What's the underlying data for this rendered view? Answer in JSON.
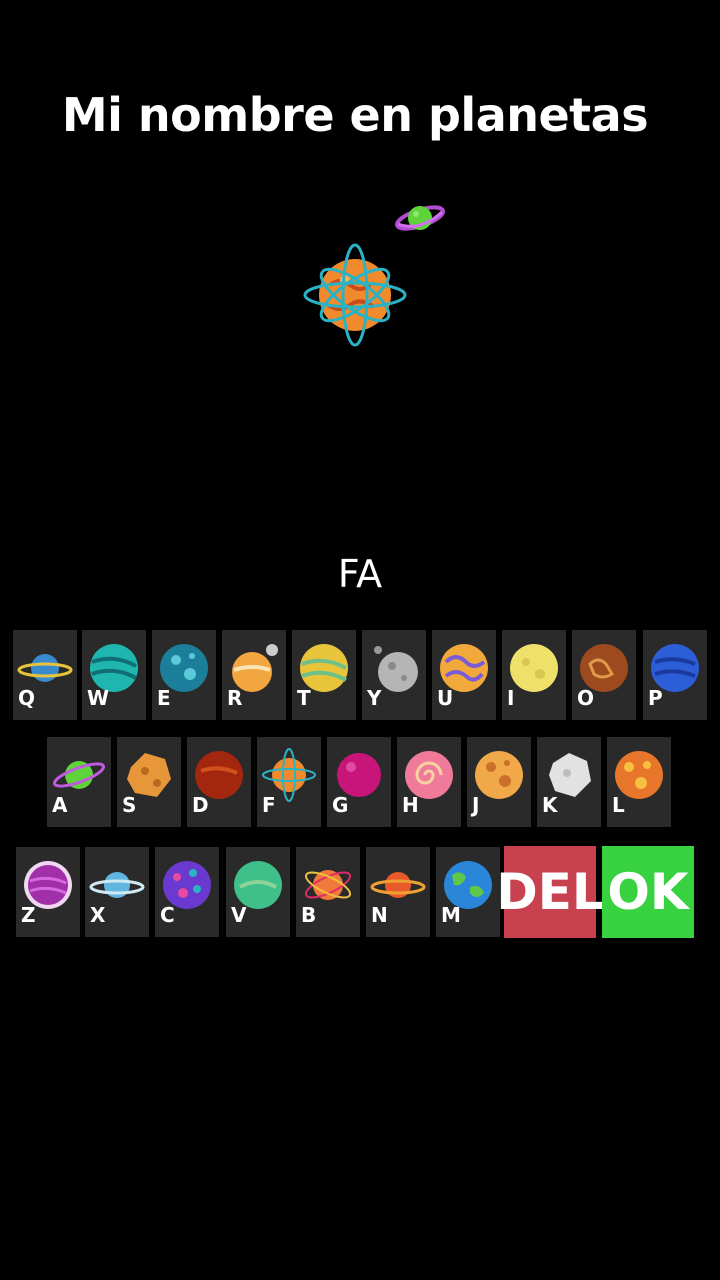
{
  "title": "Mi nombre en planetas",
  "typed_text": "FA",
  "keyboard": {
    "row1": [
      "Q",
      "W",
      "E",
      "R",
      "T",
      "Y",
      "U",
      "I",
      "O",
      "P"
    ],
    "row2": [
      "A",
      "S",
      "D",
      "F",
      "G",
      "H",
      "J",
      "K",
      "L"
    ],
    "row3": [
      "Z",
      "X",
      "C",
      "V",
      "B",
      "N",
      "M"
    ]
  },
  "actions": {
    "delete_label": "DEL",
    "ok_label": "OK"
  },
  "colors": {
    "background": "#000000",
    "key_bg": "#2a2a2a",
    "delete": "#c8414f",
    "ok": "#38d13f"
  },
  "planet_icons": {
    "Q": "blue-ringed-planet-icon",
    "W": "teal-planet-icon",
    "E": "blue-crater-planet-icon",
    "R": "orange-planet-moon-icon",
    "T": "yellow-green-planet-icon",
    "Y": "grey-moon-icon",
    "U": "swirl-planet-icon",
    "I": "yellow-moon-icon",
    "O": "brown-planet-icon",
    "P": "blue-planet-icon",
    "A": "green-ringed-planet-icon",
    "S": "orange-asteroid-icon",
    "D": "red-planet-icon",
    "F": "orange-orbit-planet-icon",
    "G": "magenta-planet-icon",
    "H": "pink-swirl-planet-icon",
    "J": "orange-crater-planet-icon",
    "K": "white-asteroid-icon",
    "L": "orange-spotted-planet-icon",
    "Z": "purple-planet-icon",
    "X": "blue-ringed-small-icon",
    "C": "purple-spotted-planet-icon",
    "V": "green-planet-icon",
    "B": "striped-orbit-planet-icon",
    "N": "orange-ringed-planet-icon",
    "M": "earth-planet-icon"
  }
}
